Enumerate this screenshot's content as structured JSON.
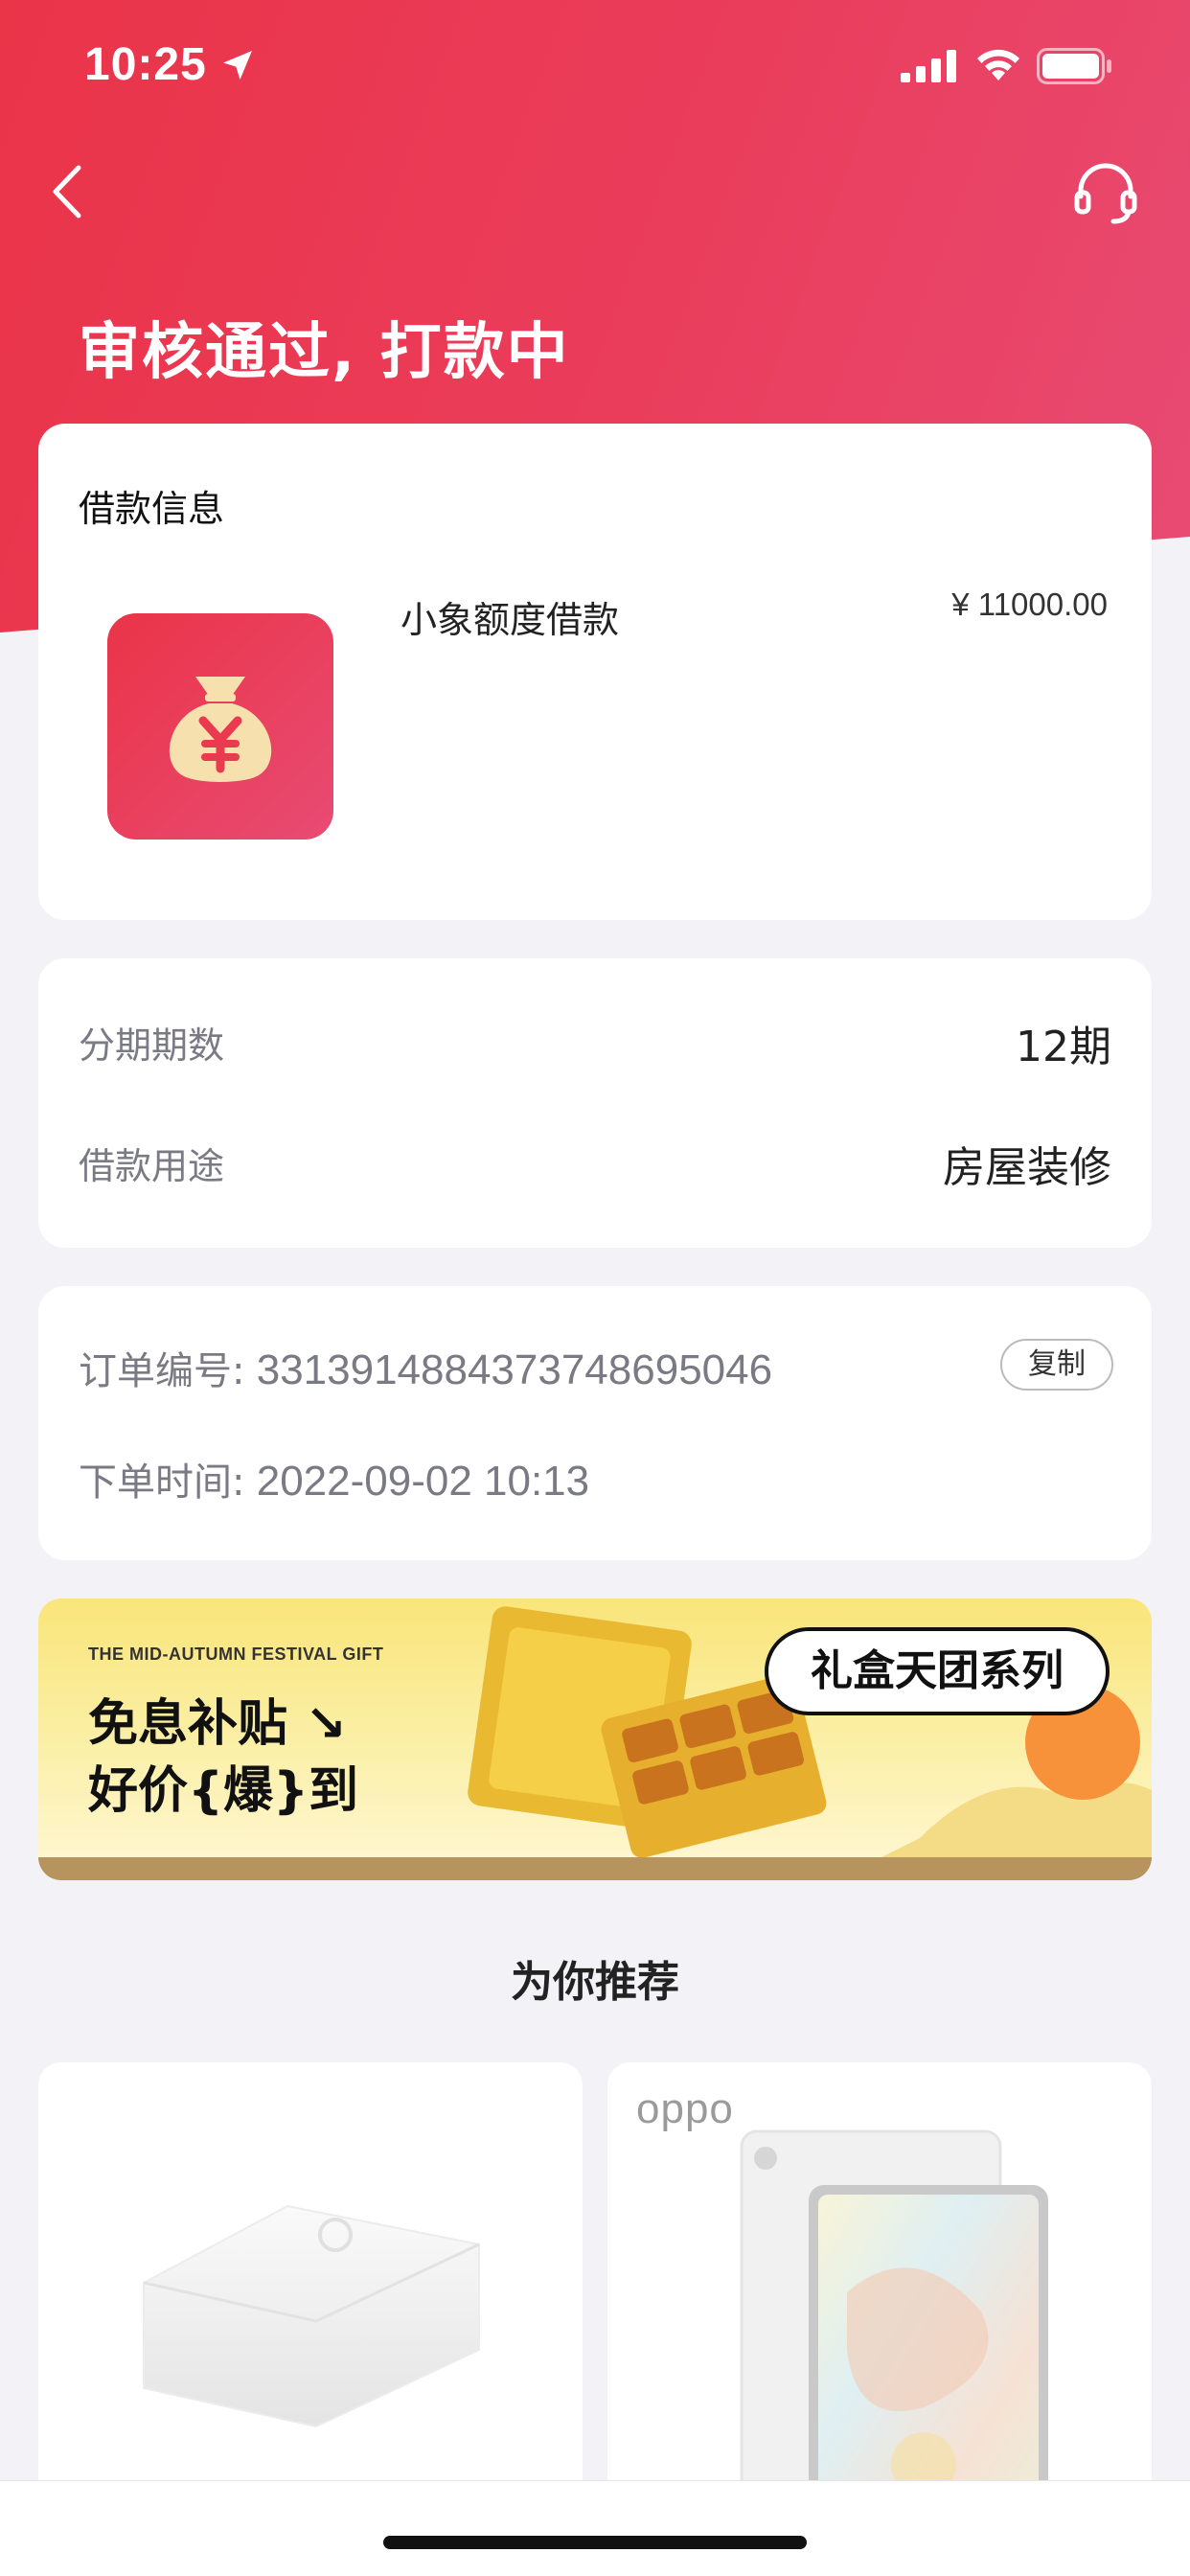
{
  "status_bar": {
    "time": "10:25"
  },
  "header": {
    "title": "审核通过, 打款中"
  },
  "loan_card": {
    "title": "借款信息",
    "product_icon": "money-bag-yen-icon",
    "product_name": "小象额度借款",
    "amount": "¥ 11000.00"
  },
  "terms_card": {
    "rows": [
      {
        "label": "分期期数",
        "value": "12期"
      },
      {
        "label": "借款用途",
        "value": "房屋装修"
      }
    ]
  },
  "order_card": {
    "order_no_label": "订单编号:",
    "order_no": "3313914884373748695046",
    "copy_label": "复制",
    "time_label": "下单时间:",
    "time_value": "2022-09-02 10:13"
  },
  "banner": {
    "subtitle": "THE MID-AUTUMN FESTIVAL GIFT",
    "line1": "免息补贴 ↘",
    "line2": "好价{爆}到",
    "bubble": "礼盒天团系列"
  },
  "recommend": {
    "title": "为你推荐",
    "items": [
      {
        "brand": "",
        "image": "white-speaker-product"
      },
      {
        "brand": "oppo",
        "image": "oppo-tablet-product"
      }
    ]
  },
  "colors": {
    "header_start": "#ea3448",
    "header_end": "#e84b73",
    "page_bg": "#f3f2f7"
  }
}
